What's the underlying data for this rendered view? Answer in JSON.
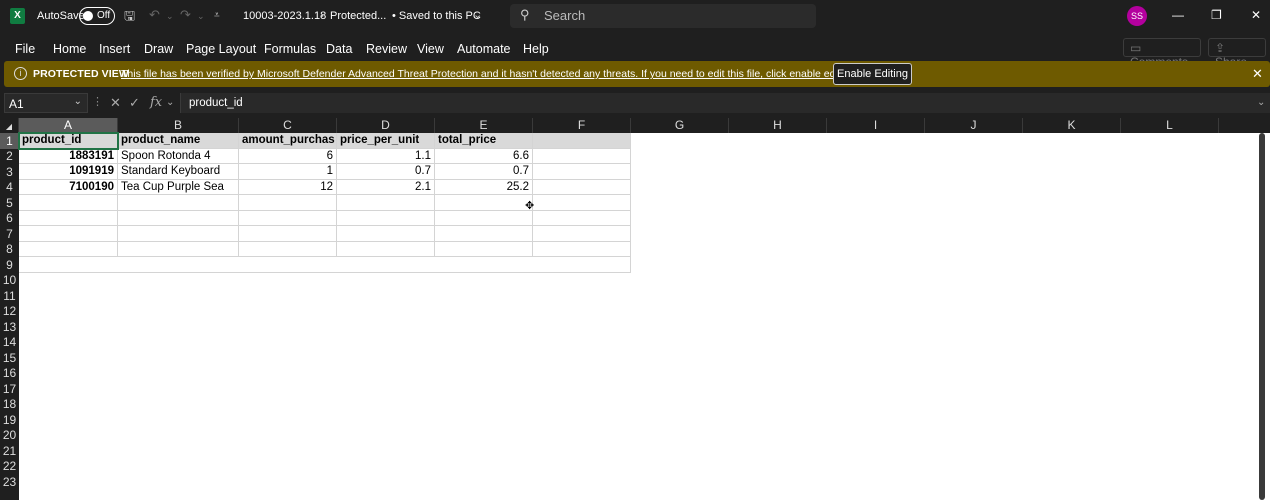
{
  "titlebar": {
    "logo": "X",
    "autosave_label": "AutoSave",
    "toggle_state": "Off",
    "doc_title": "10003-2023.1.18",
    "separator": "-",
    "status": "Protected...",
    "saved": "• Saved to this PC",
    "search_placeholder": "Search",
    "avatar_initials": "SS"
  },
  "ribbon": {
    "tabs": [
      "File",
      "Home",
      "Insert",
      "Draw",
      "Page Layout",
      "Formulas",
      "Data",
      "Review",
      "View",
      "Automate",
      "Help"
    ],
    "comments_label": "Comments",
    "share_label": "Share"
  },
  "protected_bar": {
    "title": "PROTECTED VIEW",
    "message": "This file has been verified by Microsoft Defender Advanced Threat Protection and it hasn't detected any threats. If you need to edit this file, click enable editing.",
    "enable_label": "Enable Editing"
  },
  "formula_bar": {
    "name_box": "A1",
    "fx_label": "fx",
    "formula": "product_id"
  },
  "columns": [
    "A",
    "B",
    "C",
    "D",
    "E",
    "F",
    "G",
    "H",
    "I",
    "J",
    "K",
    "L"
  ],
  "rows": [
    "1",
    "2",
    "3",
    "4",
    "5",
    "6",
    "7",
    "8",
    "9",
    "10",
    "11",
    "12",
    "13",
    "14",
    "15",
    "16",
    "17",
    "18",
    "19",
    "20",
    "21",
    "22",
    "23"
  ],
  "table": {
    "headers": [
      "product_id",
      "product_name",
      "amount_purchas",
      "price_per_unit",
      "total_price"
    ],
    "data": [
      [
        "1883191",
        "Spoon Rotonda 4",
        "6",
        "1.1",
        "6.6"
      ],
      [
        "1091919",
        "Standard Keyboard",
        "1",
        "0.7",
        "0.7"
      ],
      [
        "7100190",
        "Tea Cup Purple Sea",
        "12",
        "2.1",
        "25.2"
      ]
    ]
  },
  "colors": {
    "accent": "#217346",
    "protected_bar": "#6e5a00",
    "header_fill": "#d9d9d9"
  }
}
